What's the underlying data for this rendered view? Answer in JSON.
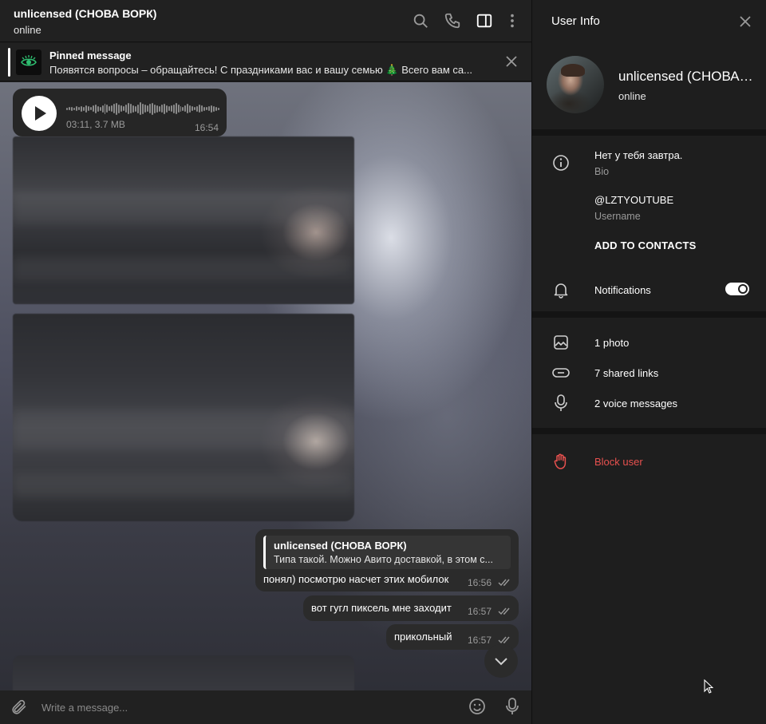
{
  "chat": {
    "title": "unlicensed (СНОВА ВОРК)",
    "status": "online",
    "header_icons": [
      "search-icon",
      "phone-icon",
      "sidebar-toggle-icon",
      "more-vertical-icon"
    ]
  },
  "pinned": {
    "label": "Pinned message",
    "text": "Появятся вопросы – обращайтесь! С праздниками вас и вашу семью 🎄 Всего вам са..."
  },
  "voice_message": {
    "meta": "03:11, 3.7 MB",
    "time": "16:54"
  },
  "reply_message": {
    "quote_author": "unlicensed (СНОВА ВОРК)",
    "quote_text": "Типа такой. Можно Авито доставкой, в этом с...",
    "text": "понял) посмотрю насчет этих мобилок",
    "time": "16:56"
  },
  "messages": [
    {
      "text": "вот гугл пиксель мне заходит",
      "time": "16:57"
    },
    {
      "text": "прикольный",
      "time": "16:57"
    }
  ],
  "composer": {
    "placeholder": "Write a message..."
  },
  "info": {
    "title": "User Info",
    "name": "unlicensed (СНОВА ВОРК)",
    "status": "online",
    "bio": "Нет у тебя завтра.",
    "bio_label": "Bio",
    "username": "@LZTYOUTUBE",
    "username_label": "Username",
    "add_contacts": "ADD TO CONTACTS",
    "notifications": "Notifications",
    "notifications_on": true,
    "media": [
      {
        "label": "1 photo",
        "icon": "photo-icon"
      },
      {
        "label": "7 shared links",
        "icon": "link-icon"
      },
      {
        "label": "2 voice messages",
        "icon": "mic-icon"
      }
    ],
    "block_user": "Block user"
  },
  "colors": {
    "panel_bg": "#1e1e1e",
    "header_bg": "#212121",
    "bubble_bg": "#2b2b2b",
    "danger": "#e8514f",
    "muted_text": "#9a9a9a"
  }
}
